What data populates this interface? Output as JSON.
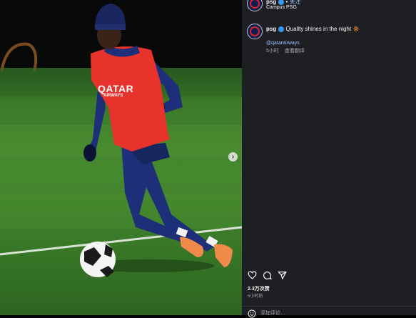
{
  "header": {
    "username": "psg",
    "follow_label": "关注",
    "location": "Campus PSG"
  },
  "caption": {
    "username": "psg",
    "text": "Quality shines in the night",
    "emoji": "🔅",
    "mention": "@qatarairways",
    "time": "5小时",
    "translate_label": "查看翻译"
  },
  "actions": {
    "likes": "2.3万次赞",
    "time": "5小时前",
    "comment_placeholder": "添加评论…"
  },
  "photo": {
    "bib_text_1": "QATAR",
    "bib_text_2": "AIRWAYS"
  },
  "icons": {
    "like": "heart-icon",
    "comment": "comment-icon",
    "share": "share-icon",
    "next": "chevron-right-icon",
    "emoji": "emoji-icon"
  },
  "colors": {
    "panel": "#1e1f22",
    "verified": "#3897f0",
    "link": "#9ec4ff",
    "bib": "#e8322c",
    "kit": "#1c2f78"
  }
}
